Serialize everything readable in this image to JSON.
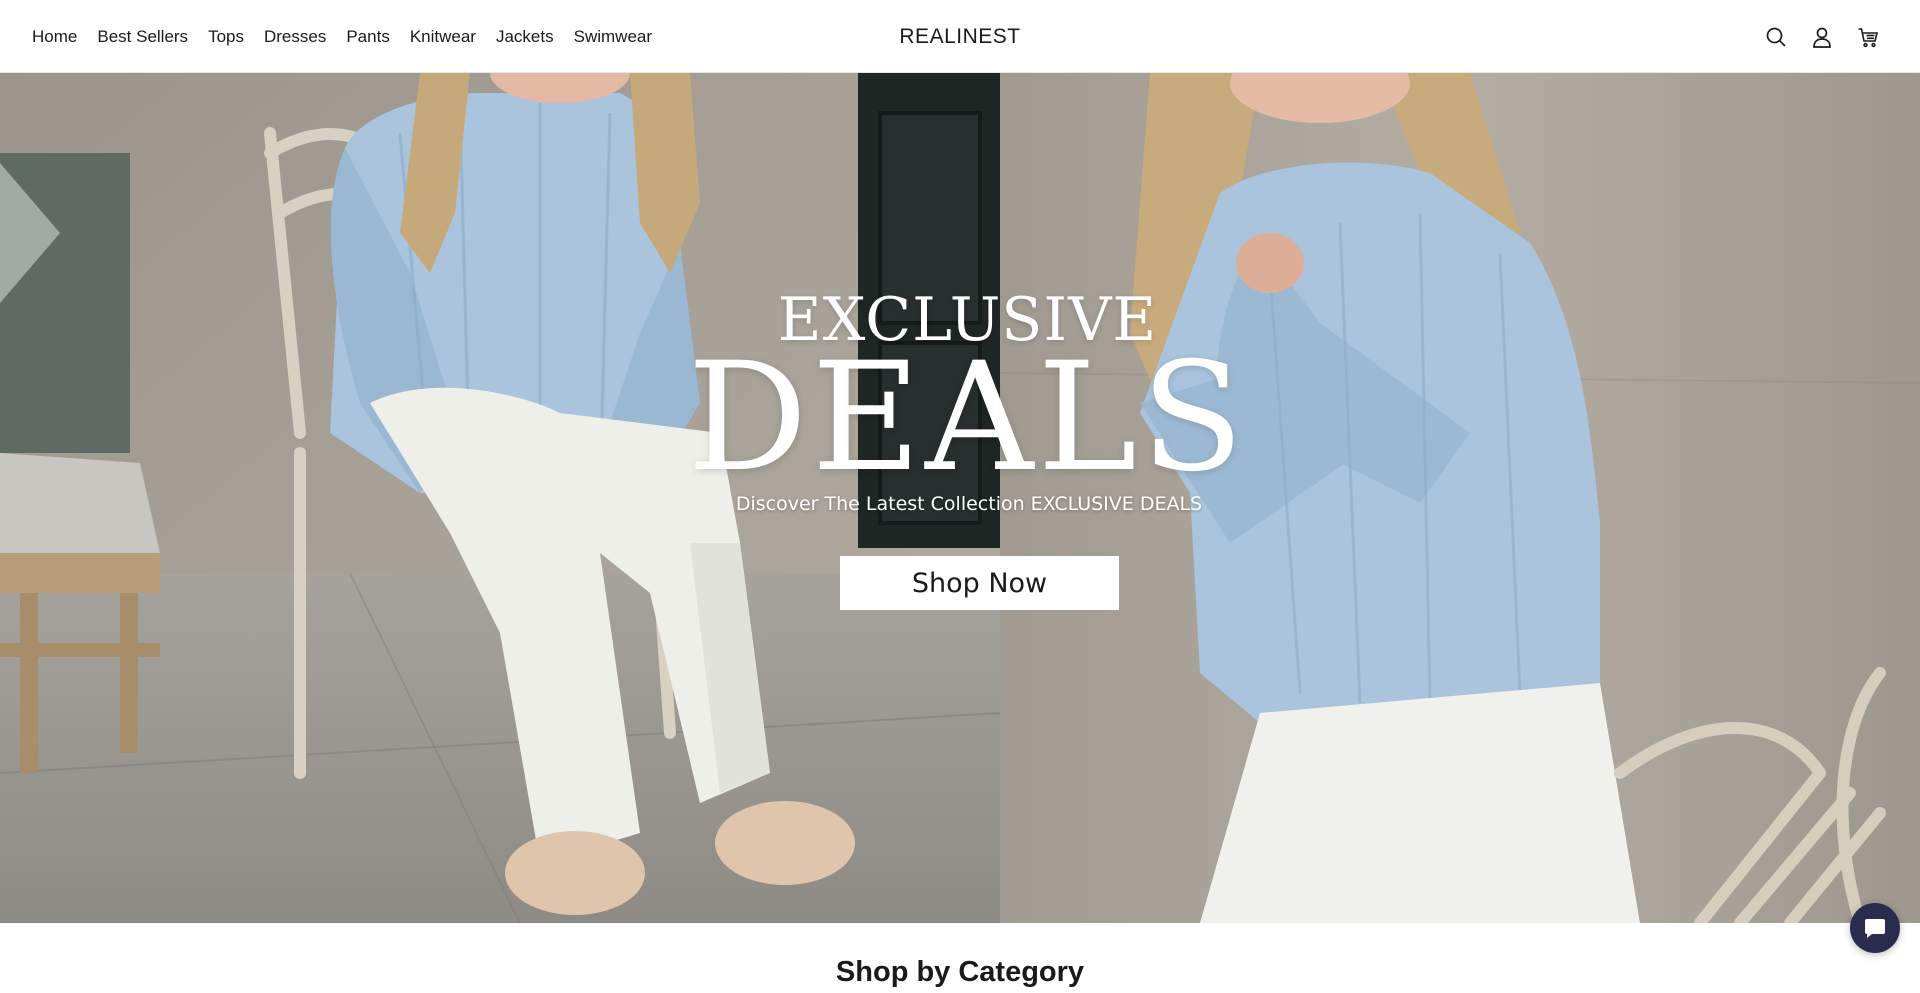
{
  "header": {
    "nav": [
      "Home",
      "Best Sellers",
      "Tops",
      "Dresses",
      "Pants",
      "Knitwear",
      "Jackets",
      "Swimwear"
    ],
    "brand": "REALINEST",
    "icons": [
      "search-icon",
      "account-icon",
      "cart-icon"
    ]
  },
  "hero": {
    "eyebrow": "EXCLUSIVE",
    "headline": "DEALS",
    "subtitle": "Discover The Latest Collection EXCLUSIVE DEALS",
    "cta": "Shop Now"
  },
  "sections": {
    "category_title": "Shop by Category"
  },
  "chat": {
    "icon": "chat-bubble-icon"
  },
  "colors": {
    "text": "#1a1a1a",
    "sweater_blue": "#a9c4dc",
    "pants_white": "#efefea",
    "wall_stone": "#a39c92",
    "chat_button": "#2a2c4e"
  }
}
